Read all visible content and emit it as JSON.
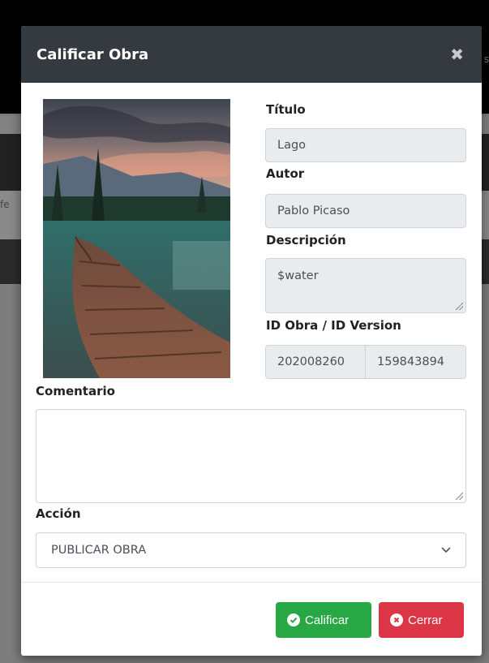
{
  "background": {
    "fragment_left": "fe",
    "fragment_right": "s"
  },
  "modal": {
    "title": "Calificar Obra",
    "close_icon": "times-icon"
  },
  "artwork": {
    "alt": "lake wooden boardwalk at sunset"
  },
  "fields": {
    "titulo": {
      "label": "Título",
      "value": "Lago"
    },
    "autor": {
      "label": "Autor",
      "value": "Pablo Picaso"
    },
    "descripcion": {
      "label": "Descripción",
      "value": "$water"
    },
    "ids": {
      "label": "ID Obra / ID Version",
      "id_obra": "202008260",
      "id_version": "159843894"
    }
  },
  "comentario": {
    "label": "Comentario",
    "value": ""
  },
  "accion": {
    "label": "Acción",
    "selected": "PUBLICAR OBRA"
  },
  "footer": {
    "calificar_label": "Calificar",
    "cerrar_label": "Cerrar"
  },
  "colors": {
    "header_bg": "#343a40",
    "success": "#28a745",
    "danger": "#dc3545",
    "readonly_field": "#e9ecef"
  }
}
